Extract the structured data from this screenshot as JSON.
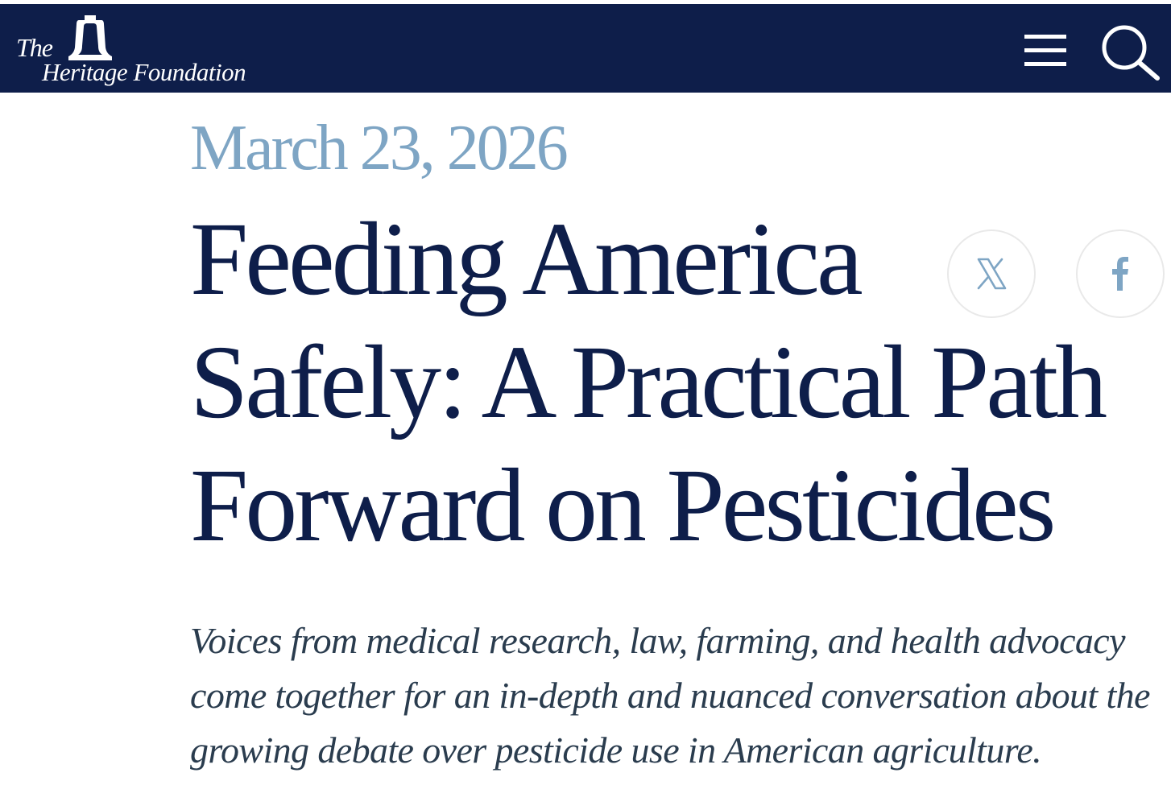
{
  "header": {
    "logo_the": "The",
    "logo_name": "Heritage Foundation",
    "menu_icon": "hamburger-menu-icon",
    "search_icon": "search-icon",
    "background_color": "#0e1e4a"
  },
  "article": {
    "date": "March 23, 2026",
    "title": "Feeding America Safely: A Practical Path Forward on Pesticides",
    "subtitle": "Voices from medical research, law, farming, and health advocacy come together for an in-depth and nuanced conversation about the growing debate over pesticide use in American agriculture."
  },
  "share": {
    "buttons": [
      {
        "network": "X",
        "icon": "x-logo-icon"
      },
      {
        "network": "Facebook",
        "icon": "facebook-icon"
      }
    ],
    "icon_color": "#7ea5c4"
  },
  "colors": {
    "navy": "#0e1e4a",
    "date_blue": "#7ea5c4",
    "subtitle_text": "#2a3c4e"
  }
}
